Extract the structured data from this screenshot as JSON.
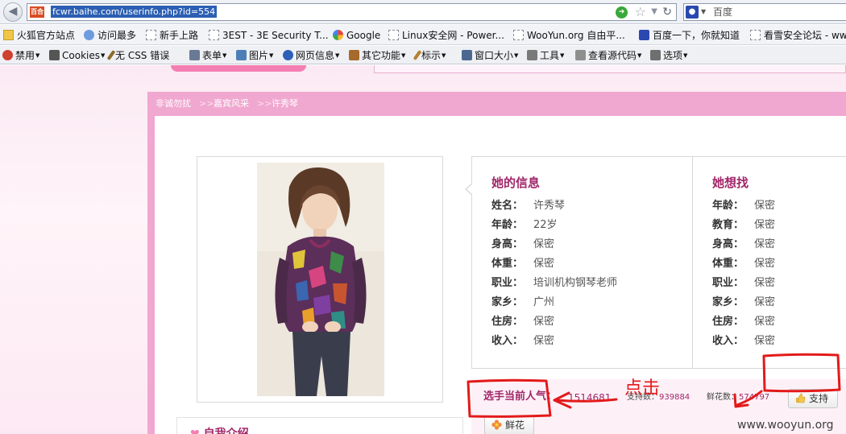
{
  "browser": {
    "favicon_text": "百合",
    "url": "fcwr.baihe.com/userinfo.php?id=554",
    "search_placeholder": "百度"
  },
  "bookmarks": [
    {
      "label": "火狐官方站点",
      "icon": "folder-icon"
    },
    {
      "label": "访问最多",
      "icon": "search-icon"
    },
    {
      "label": "新手上路",
      "icon": "blank-page-icon"
    },
    {
      "label": "3EST - 3E Security T...",
      "icon": "blank-page-icon"
    },
    {
      "label": "Google",
      "icon": "google-icon"
    },
    {
      "label": "Linux安全网 - Power...",
      "icon": "blank-page-icon"
    },
    {
      "label": "WooYun.org  自由平...",
      "icon": "blank-page-icon"
    },
    {
      "label": "百度一下，你就知道",
      "icon": "paw-icon"
    },
    {
      "label": "看雪安全论坛 - www",
      "icon": "blank-page-icon"
    }
  ],
  "toolbar": [
    {
      "label": "禁用",
      "icon": "disable-icon",
      "color": "#d0402f"
    },
    {
      "label": "Cookies",
      "icon": "person-icon",
      "color": "#555555"
    },
    {
      "label": "无 CSS 错误",
      "icon": "wand-icon",
      "color": "#8b6a2a"
    },
    {
      "label": "表单",
      "icon": "form-icon",
      "color": "#6a7a95"
    },
    {
      "label": "图片",
      "icon": "image-icon",
      "color": "#4d7fb6"
    },
    {
      "label": "网页信息",
      "icon": "info-icon",
      "color": "#2d5fb8"
    },
    {
      "label": "其它功能",
      "icon": "misc-icon",
      "color": "#a66a2a"
    },
    {
      "label": "标示",
      "icon": "pen-icon",
      "color": "#b3812f"
    },
    {
      "label": "窗口大小",
      "icon": "window-icon",
      "color": "#4b6990"
    },
    {
      "label": "工具",
      "icon": "tools-icon",
      "color": "#7a7a7a"
    },
    {
      "label": "查看源代码",
      "icon": "source-icon",
      "color": "#8e8e8e"
    },
    {
      "label": "选项",
      "icon": "options-icon",
      "color": "#6f6f6f"
    }
  ],
  "breadcrumb": [
    "非诚勿扰",
    "嘉宾风采",
    "许秀琴"
  ],
  "breadcrumb_sep": ">>",
  "her_info": {
    "title": "她的信息",
    "fields": [
      {
        "label": "姓名：",
        "value": "许秀琴"
      },
      {
        "label": "年龄：",
        "value": "22岁"
      },
      {
        "label": "身高：",
        "value": "保密"
      },
      {
        "label": "体重：",
        "value": "保密"
      },
      {
        "label": "职业：",
        "value": "培训机构钢琴老师"
      },
      {
        "label": "家乡：",
        "value": "广州"
      },
      {
        "label": "住房：",
        "value": "保密"
      },
      {
        "label": "收入：",
        "value": "保密"
      }
    ]
  },
  "she_seeks": {
    "title": "她想找",
    "fields": [
      {
        "label": "年龄：",
        "value": "保密"
      },
      {
        "label": "教育：",
        "value": "保密"
      },
      {
        "label": "身高：",
        "value": "保密"
      },
      {
        "label": "体重：",
        "value": "保密"
      },
      {
        "label": "职业：",
        "value": "保密"
      },
      {
        "label": "家乡：",
        "value": "保密"
      },
      {
        "label": "住房：",
        "value": "保密"
      },
      {
        "label": "收入：",
        "value": "保密"
      }
    ]
  },
  "popularity": {
    "title": "选手当前人气：",
    "value": "1514681",
    "support_label": "支持数：",
    "support_value": "939884",
    "flower_label": "鲜花数：",
    "flower_value": "574797",
    "support_button": "支持",
    "flower_button": "鲜花"
  },
  "intro": {
    "title": "自我介绍"
  },
  "annotation": {
    "click_text": "点击",
    "color": "#e31a1a"
  },
  "watermark": "www.wooyun.org",
  "colors": {
    "brand_pink": "#f0a7d0",
    "title_purple": "#a1276a"
  }
}
